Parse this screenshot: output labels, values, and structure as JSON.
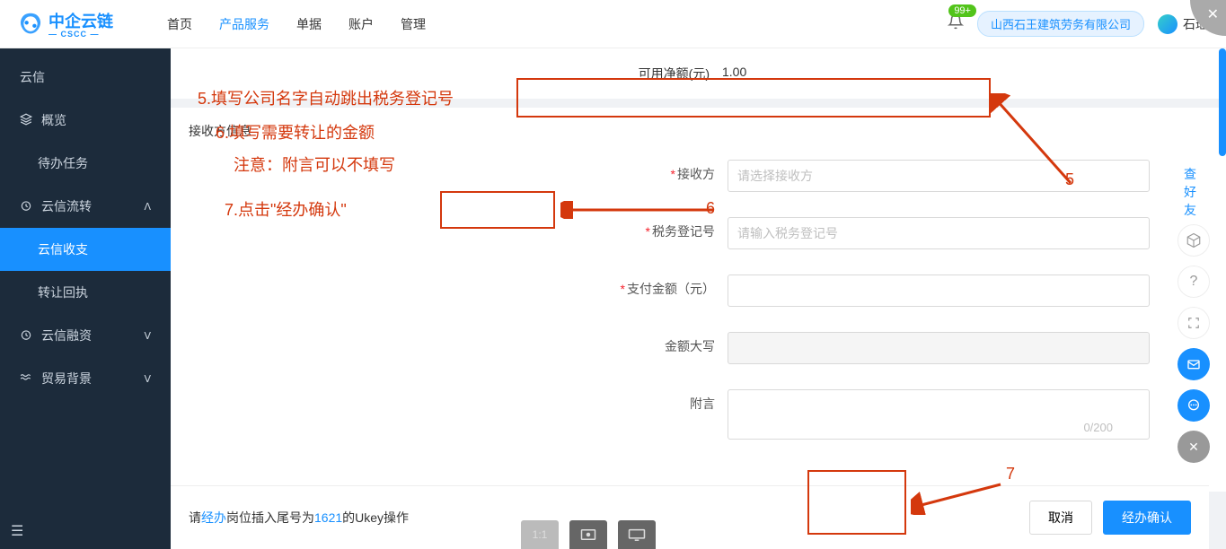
{
  "header": {
    "logo_text": "中企云链",
    "logo_sub": "— CSCC —",
    "nav": [
      "首页",
      "产品服务",
      "单据",
      "账户",
      "管理"
    ],
    "active_nav": 1,
    "badge": "99+",
    "company": "山西石王建筑劳务有限公司",
    "user": "石瑶"
  },
  "sidebar": {
    "items": [
      {
        "label": "云信",
        "icon": ""
      },
      {
        "label": "概览",
        "icon": "layers"
      },
      {
        "label": "待办任务",
        "icon": ""
      },
      {
        "label": "云信流转",
        "icon": "dashboard",
        "expanded": true
      },
      {
        "label": "云信收支",
        "icon": "",
        "active": true
      },
      {
        "label": "转让回执",
        "icon": ""
      },
      {
        "label": "云信融资",
        "icon": "dashboard",
        "expanded": false
      },
      {
        "label": "贸易背景",
        "icon": "waves",
        "expanded": false
      }
    ]
  },
  "topinfo": {
    "label": "可用净额(元)",
    "value": "1.00"
  },
  "section": {
    "title": "接收方信息",
    "fields": {
      "recipient_label": "接收方",
      "recipient_placeholder": "请选择接收方",
      "tax_label": "税务登记号",
      "tax_placeholder": "请输入税务登记号",
      "amount_label": "支付金额（元）",
      "amount_caps_label": "金额大写",
      "memo_label": "附言",
      "memo_count": "0/200",
      "friends_link": "查好友"
    }
  },
  "annotations": {
    "a5": "5.填写公司名字自动跳出税务登记号",
    "a6": "6.填写需要转让的金额",
    "a6b": "注意：附言可以不填写",
    "a7": "7.点击\"经办确认\"",
    "n5": "5",
    "n6": "6",
    "n7": "7"
  },
  "footer": {
    "text_pre": "请",
    "text_blue1": "经办",
    "text_mid": "岗位插入尾号为",
    "text_blue2": "1621",
    "text_suf": "的Ukey操作",
    "cancel": "取消",
    "confirm": "经办确认"
  },
  "toolbar": {
    "t1": "1:1"
  }
}
